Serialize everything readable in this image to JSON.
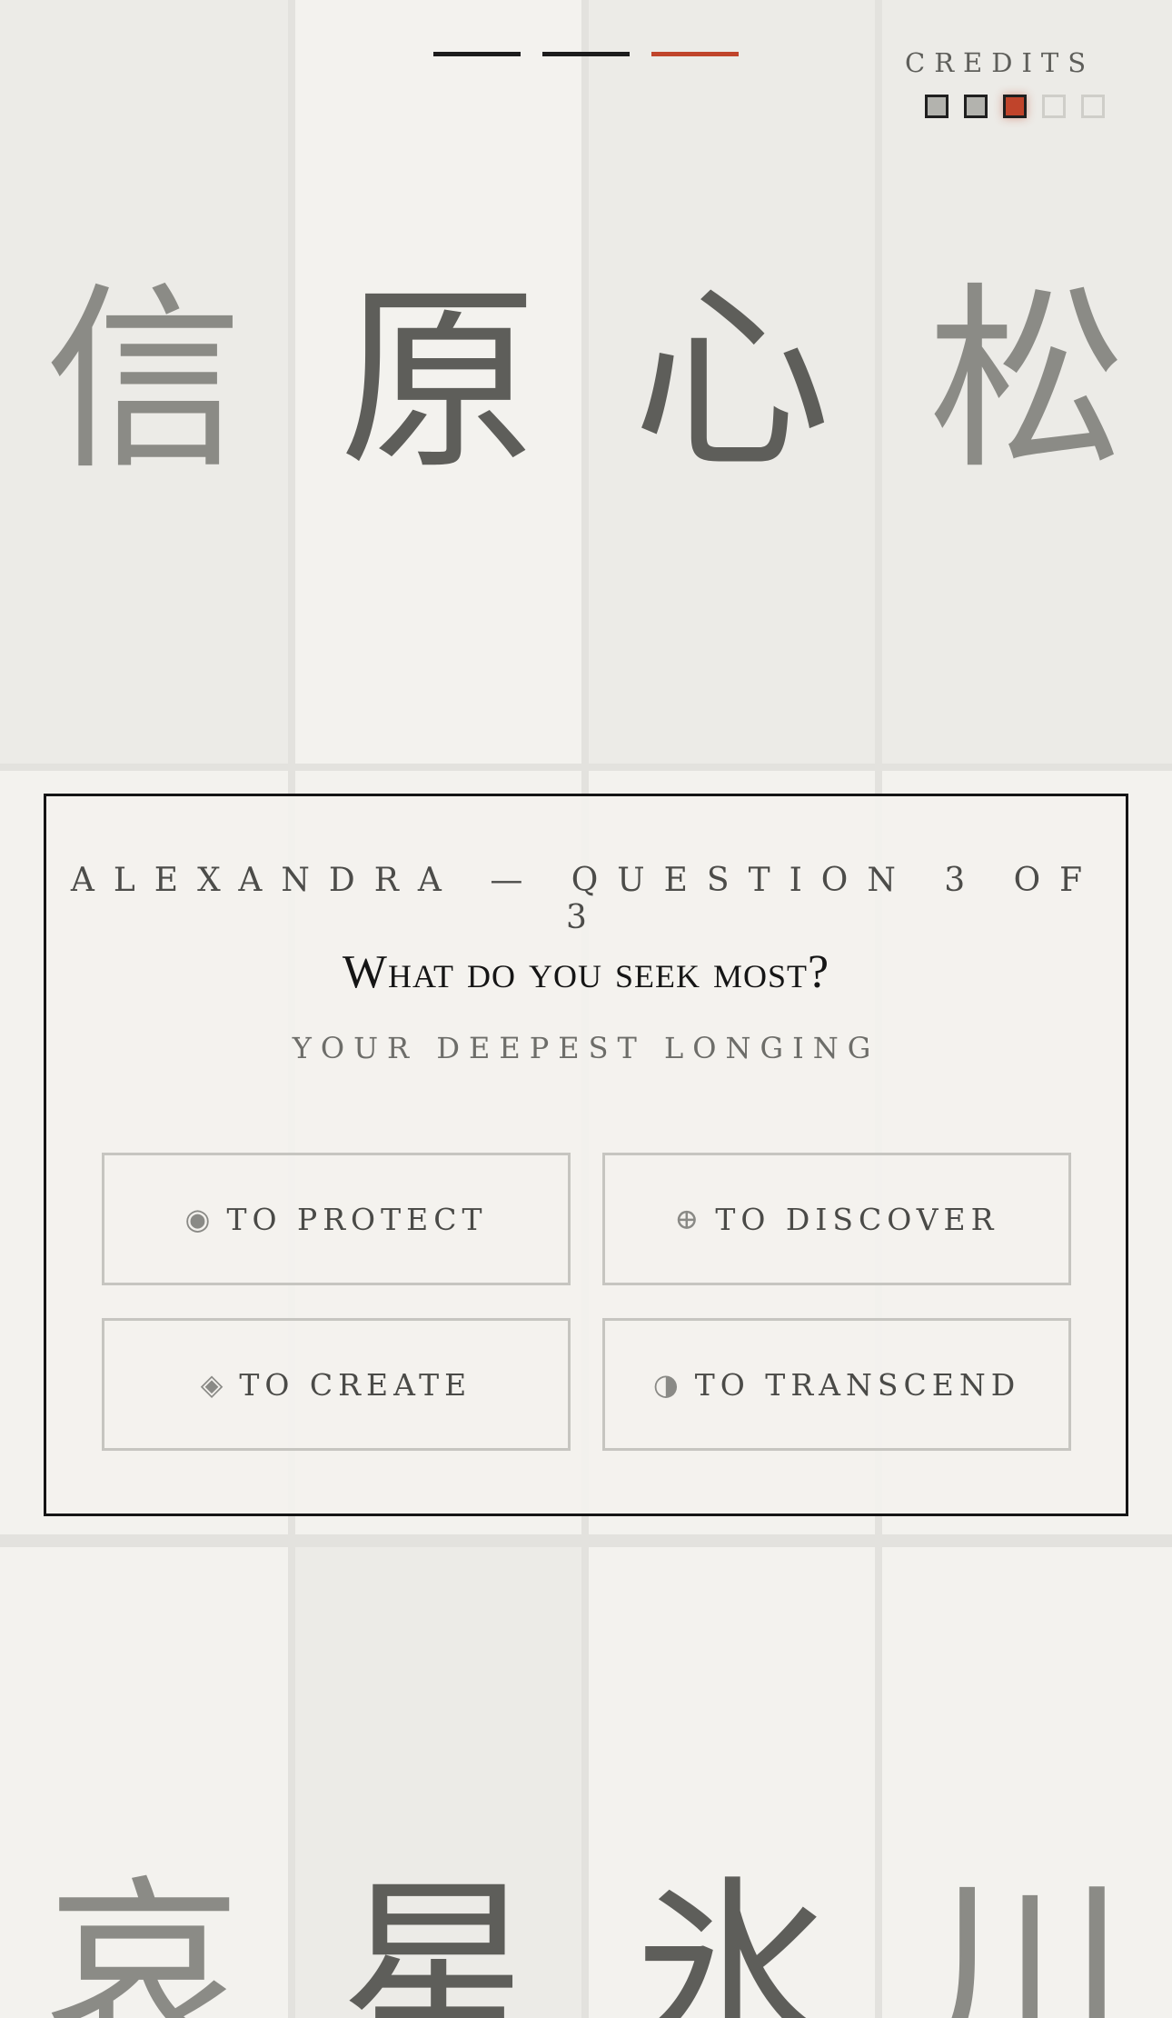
{
  "background_glyphs": {
    "top_row": [
      "信",
      "原",
      "心",
      "松"
    ],
    "bottom_row": [
      "哀",
      "星",
      "氷",
      "川"
    ]
  },
  "progress": {
    "total_steps": 3,
    "current_step": 3
  },
  "credits": {
    "label": "CREDITS",
    "total": 5,
    "spent": 2,
    "current_index": 3
  },
  "question_card": {
    "header": "ALEXANDRA — QUESTION 3 OF 3",
    "question": "What do you seek most?",
    "subtitle": "YOUR DEEPEST LONGING",
    "choices": [
      {
        "icon": "circle-dot-icon",
        "glyph": "◉",
        "label": "TO PROTECT"
      },
      {
        "icon": "circle-plus-icon",
        "glyph": "⊕",
        "label": "TO DISCOVER"
      },
      {
        "icon": "diamond-icon",
        "glyph": "◈",
        "label": "TO CREATE"
      },
      {
        "icon": "half-circle-icon",
        "glyph": "◑",
        "label": "TO TRANSCEND"
      }
    ]
  },
  "colors": {
    "accent": "#c0442b",
    "ink": "#151515",
    "paper": "#f3f2ee"
  }
}
